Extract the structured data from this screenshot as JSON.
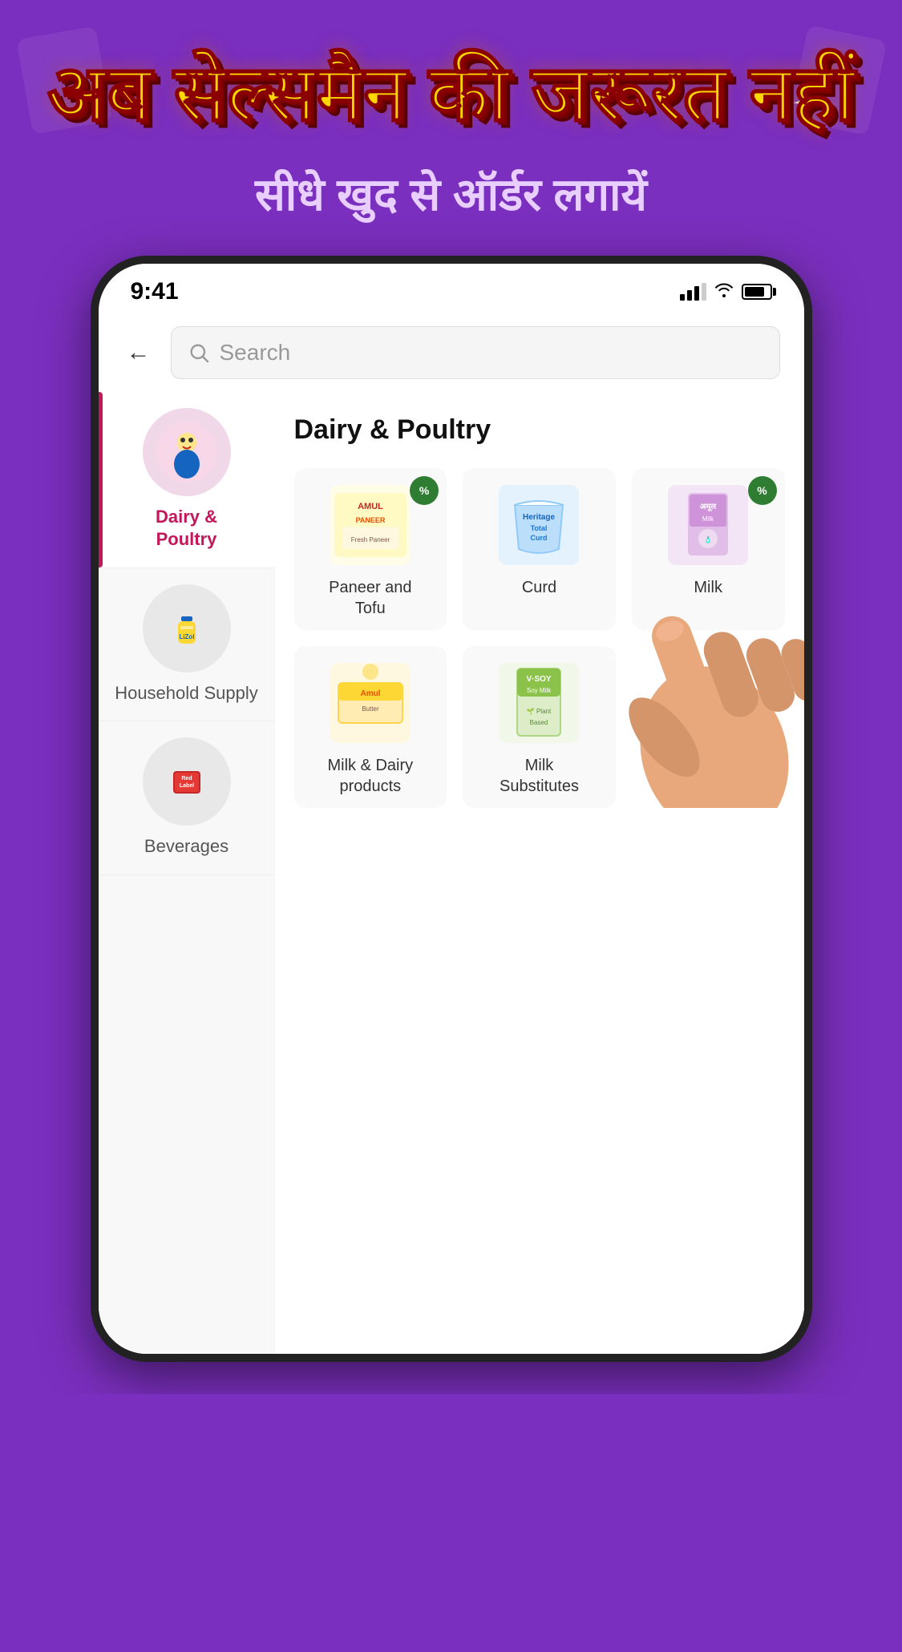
{
  "banner": {
    "main_headline": "अब सेल्समैन की जरूरत नहीं",
    "sub_headline": "सीधे खुद से ऑर्डर लगायें"
  },
  "status_bar": {
    "time": "9:41",
    "signal_label": "signal",
    "wifi_label": "wifi",
    "battery_label": "battery"
  },
  "search": {
    "placeholder": "Search",
    "back_label": "←"
  },
  "sidebar": {
    "items": [
      {
        "label": "Dairy &\nPoultry",
        "active": true
      },
      {
        "label": "Household\nSupply",
        "active": false
      },
      {
        "label": "Beverages",
        "active": false
      }
    ]
  },
  "main_content": {
    "category_title": "Dairy & Poultry",
    "products": [
      {
        "name": "Paneer and\nTofu",
        "has_badge": true,
        "badge_text": "%"
      },
      {
        "name": "Curd",
        "has_badge": false,
        "badge_text": ""
      },
      {
        "name": "Milk",
        "has_badge": true,
        "badge_text": "%"
      },
      {
        "name": "Milk & Dairy\nproducts",
        "has_badge": false,
        "badge_text": ""
      },
      {
        "name": "Milk\nSubstitutes",
        "has_badge": false,
        "badge_text": ""
      }
    ]
  }
}
